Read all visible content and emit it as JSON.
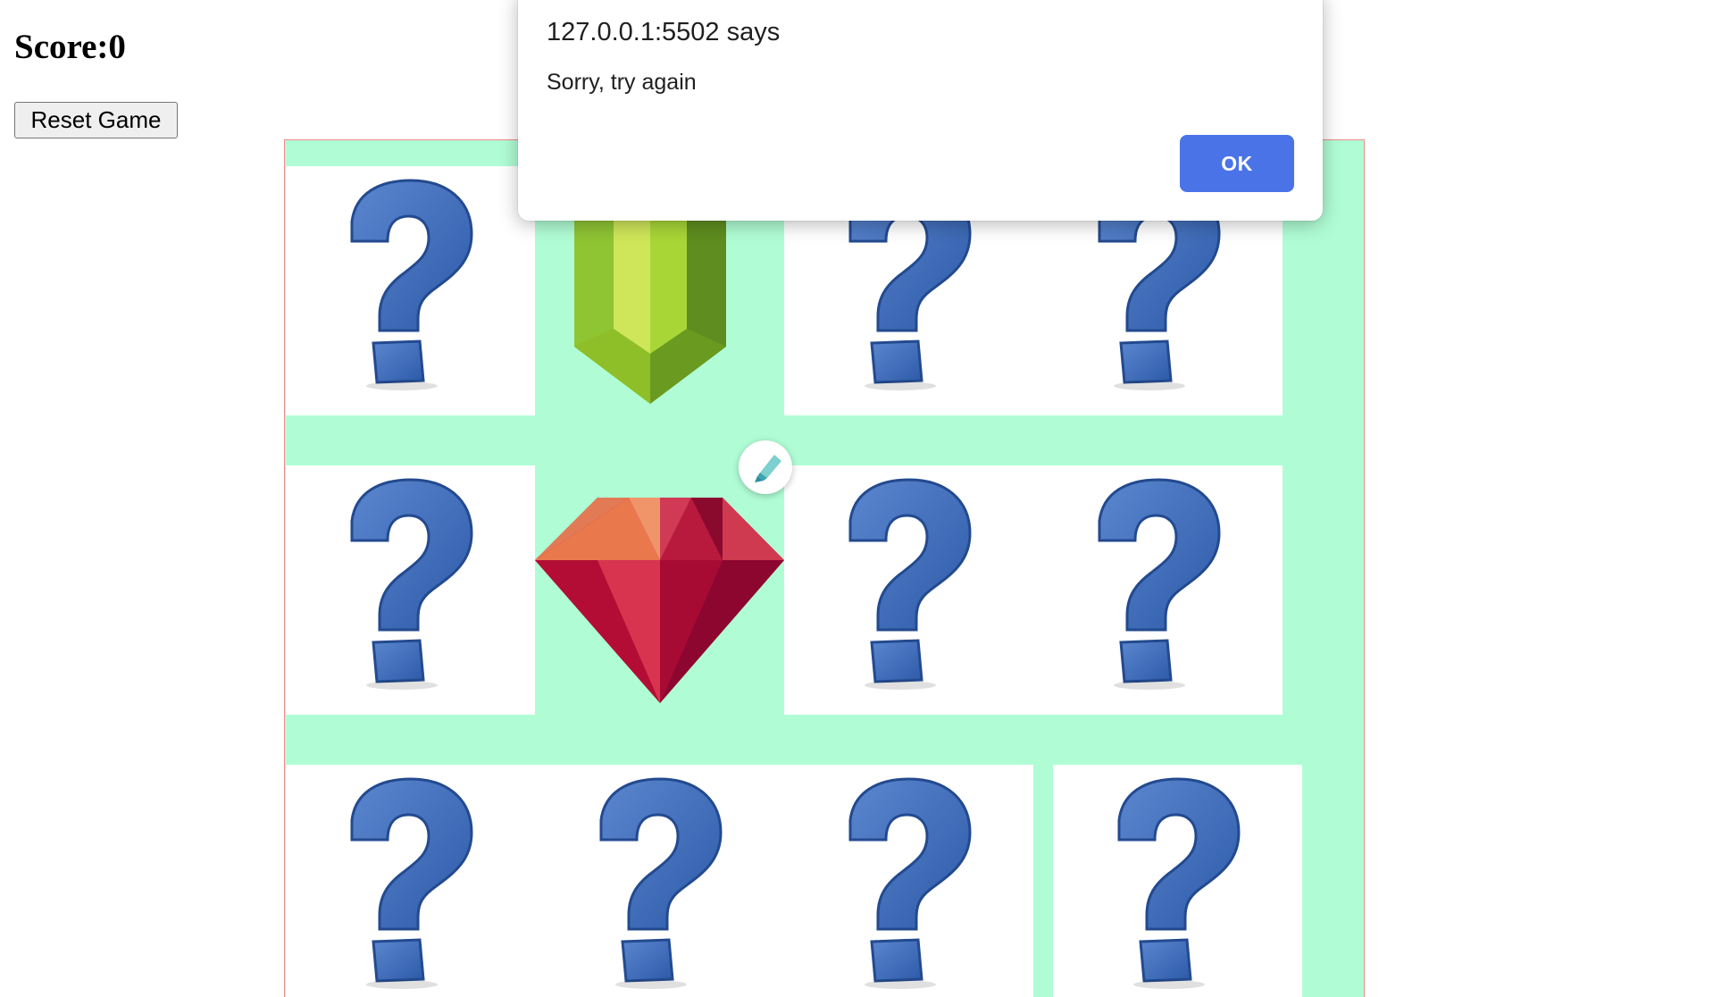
{
  "score": {
    "label": "Score:",
    "value": "0"
  },
  "controls": {
    "reset_label": "Reset Game"
  },
  "board": {
    "background": "#b0fdd5",
    "border_color": "#f08a8a",
    "cards": [
      {
        "row": 1,
        "col": 1,
        "state": "hidden",
        "icon": "question-mark-icon"
      },
      {
        "row": 1,
        "col": 2,
        "state": "revealed",
        "icon": "green-gem-icon"
      },
      {
        "row": 1,
        "col": 3,
        "state": "hidden",
        "icon": "question-mark-icon"
      },
      {
        "row": 1,
        "col": 4,
        "state": "hidden",
        "icon": "question-mark-icon"
      },
      {
        "row": 2,
        "col": 1,
        "state": "hidden",
        "icon": "question-mark-icon"
      },
      {
        "row": 2,
        "col": 2,
        "state": "revealed",
        "icon": "red-ruby-icon"
      },
      {
        "row": 2,
        "col": 3,
        "state": "hidden",
        "icon": "question-mark-icon"
      },
      {
        "row": 2,
        "col": 4,
        "state": "hidden",
        "icon": "question-mark-icon"
      },
      {
        "row": 3,
        "col": 1,
        "state": "hidden",
        "icon": "question-mark-icon"
      },
      {
        "row": 3,
        "col": 2,
        "state": "hidden",
        "icon": "question-mark-icon"
      },
      {
        "row": 3,
        "col": 3,
        "state": "hidden",
        "icon": "question-mark-icon"
      },
      {
        "row": 3,
        "col": 4,
        "state": "hidden",
        "icon": "question-mark-icon"
      }
    ]
  },
  "dialog": {
    "title": "127.0.0.1:5502 says",
    "message": "Sorry, try again",
    "ok_label": "OK",
    "ok_color": "#4a73e8"
  },
  "overlay": {
    "icon": "highlighter-icon"
  }
}
